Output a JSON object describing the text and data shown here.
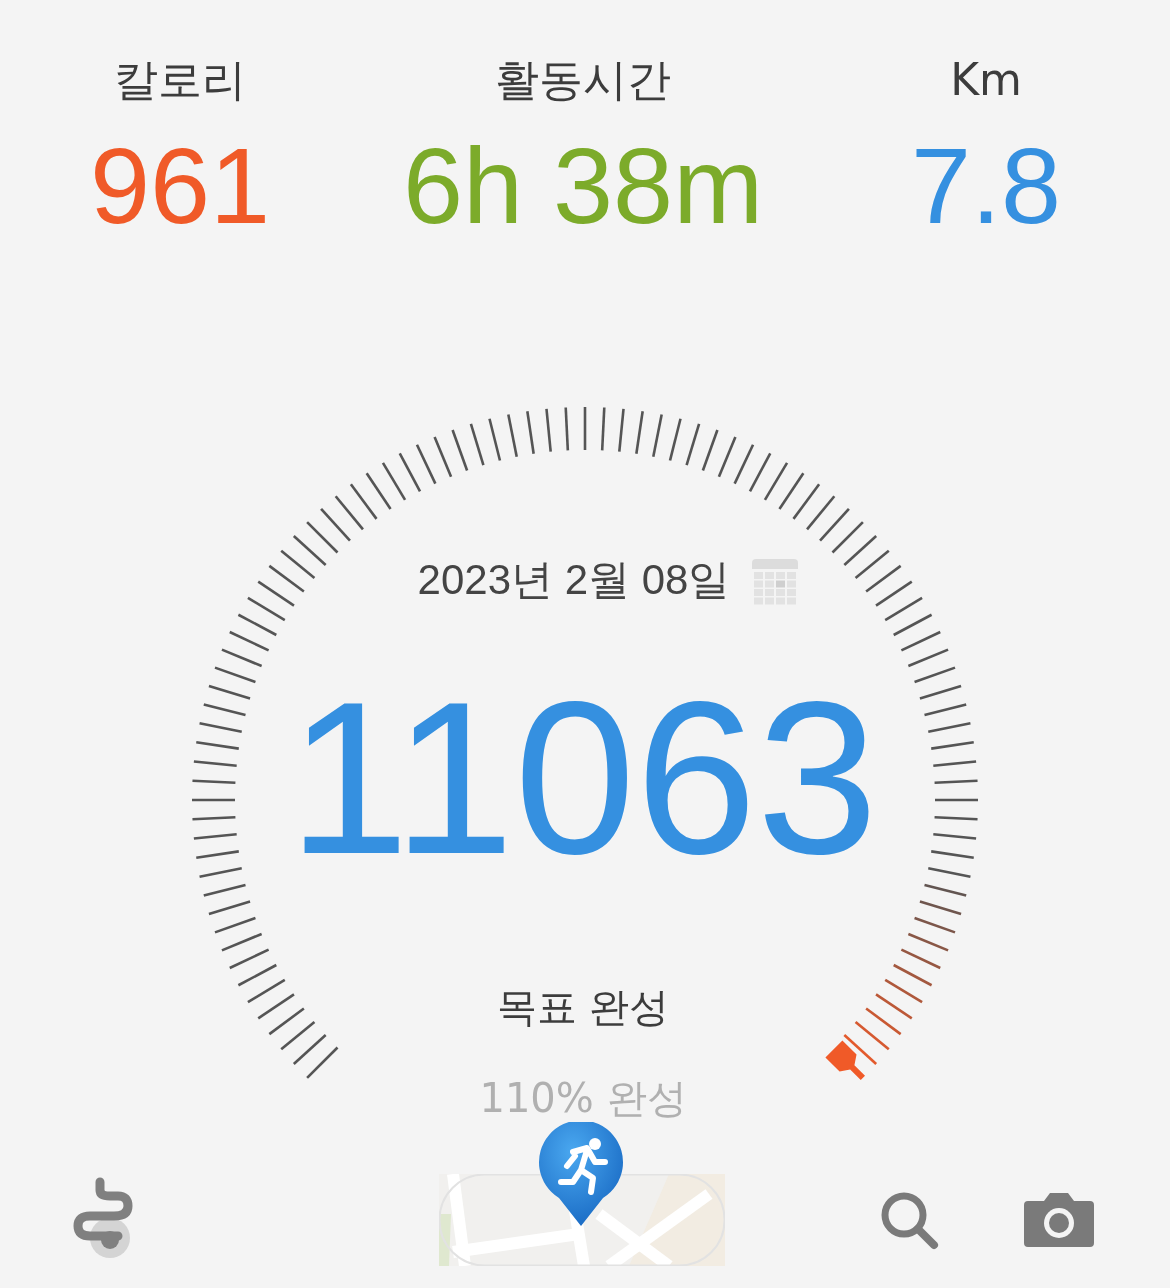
{
  "stats": [
    {
      "label": "칼로리",
      "value": "961",
      "color": "#f05a28"
    },
    {
      "label": "활동시간",
      "value": "6h 38m",
      "color": "#7cab2a"
    },
    {
      "label": "Km",
      "value": "7.8",
      "color": "#3590e0"
    }
  ],
  "gauge": {
    "date": "2023년 2월 08일",
    "steps": "11063",
    "status": "목표 완성",
    "progress": "110% 완성"
  }
}
